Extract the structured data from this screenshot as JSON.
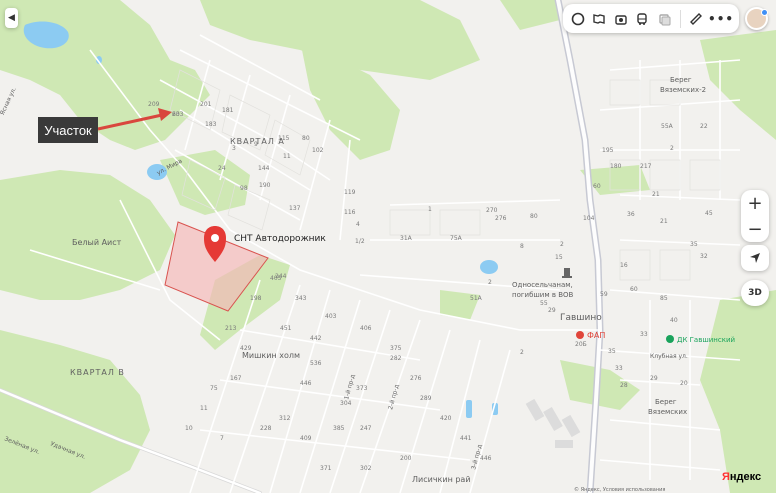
{
  "annotation": {
    "callout_text": "Участок"
  },
  "map": {
    "place_labels": {
      "snt": "СНТ Автодорожник",
      "kvartal_a": "КВАРТАЛ А",
      "kvartal_v": "КВАРТАЛ В",
      "bely_aist": "Белый Аист",
      "mishkin": "Мишкин холм",
      "lisichkin": "Лисичкин рай",
      "bereg2": "Берег\nВяземских-2",
      "bereg": "Берег\nВяземских",
      "monument": "Односельчанам,\nпогибшим в ВОВ",
      "gavshino": "Гавшино",
      "fap": "ФАП",
      "dk": "ДК Гавшинский",
      "street_mira": "ул. Мира",
      "street_klub": "Клубная ул.",
      "street_udach": "Удачная ул.",
      "street_zeleny": "Зелёная ул.",
      "street_yasnaya": "Ясная ул.",
      "street_1j": "1-й пр-д",
      "street_2j": "2-й пр-д",
      "street_3j": "3-й пр-д"
    },
    "house_numbers": [
      "203",
      "201",
      "209",
      "183",
      "181",
      "9",
      "11",
      "144",
      "190",
      "115",
      "80",
      "102",
      "137",
      "116",
      "119",
      "4",
      "1/2",
      "3",
      "24",
      "98",
      "270",
      "276",
      "1",
      "75А",
      "31А",
      "80",
      "60",
      "55А",
      "22",
      "21",
      "21",
      "45",
      "35",
      "32",
      "16",
      "2",
      "15",
      "8",
      "2",
      "51А",
      "55",
      "59",
      "60",
      "85",
      "40",
      "33",
      "35",
      "33",
      "29",
      "28",
      "20",
      "20Б",
      "2",
      "29",
      "36",
      "104",
      "195",
      "180",
      "217",
      "2",
      "244",
      "343",
      "198",
      "213",
      "405",
      "429",
      "403",
      "406",
      "451",
      "442",
      "375",
      "373",
      "304",
      "536",
      "446",
      "312",
      "409",
      "385",
      "247",
      "282",
      "276",
      "289",
      "420",
      "441",
      "446",
      "371",
      "302",
      "200",
      "228",
      "7",
      "11",
      "10",
      "75",
      "167",
      "63"
    ]
  },
  "controls": {
    "menu_icon": "chevron-left-icon",
    "toolbar_icons": [
      "layers-icon",
      "panorama-icon",
      "camera-icon",
      "bus-icon",
      "traffic-icon",
      "ruler-icon",
      "more-icon"
    ],
    "zoom_in": "+",
    "zoom_out": "−",
    "locate_icon": "navigation-arrow-icon",
    "btn3d_label": "3D"
  },
  "branding": {
    "logo_first": "Я",
    "logo_rest": "ндекс",
    "copyright": "© Яндекс, Условия использования"
  },
  "colors": {
    "forest": "#cfe8b4",
    "water": "#8ccbf2",
    "road_major": "#c7c9d3",
    "plot_fill": "#f4b7b7",
    "plot_stroke": "#d9534f",
    "marker": "#e53935",
    "arrow": "#d9473e",
    "dk_green": "#1aa35c",
    "fap_red": "#e0453a"
  }
}
